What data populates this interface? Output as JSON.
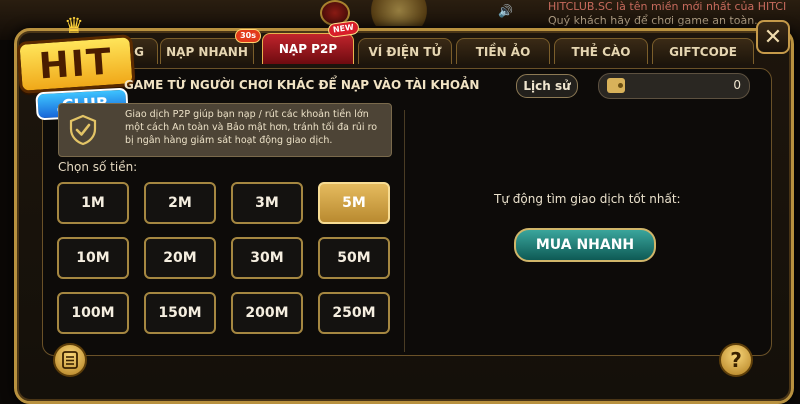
{
  "background": {
    "marquee_line1": "HITCLUB.SC là tên miền mới nhất của HITCI",
    "marquee_line2": "Quý khách hãy để chơi game an toàn."
  },
  "logo": {
    "hit": "HIT",
    "club": ".CLUB"
  },
  "tabs": [
    {
      "label": "NẠP NHANH",
      "badge": "30s"
    },
    {
      "label": "NẠP P2P",
      "badge": "NEW",
      "active": true
    },
    {
      "label": "VÍ ĐIỆN TỬ"
    },
    {
      "label": "TIỀN ẢO"
    },
    {
      "label": "THẺ CÀO"
    },
    {
      "label": "GIFTCODE"
    }
  ],
  "first_tab_fragment": "G",
  "close_icon": "close-icon",
  "header": {
    "subtitle": "GAME TỪ NGƯỜI CHƠI KHÁC ĐỂ NẠP VÀO TÀI KHOẢN",
    "history_label": "Lịch sử",
    "balance": "0"
  },
  "info": {
    "text": "Giao dịch P2P giúp bạn nạp / rút các khoản tiền lớn một cách An toàn và Bảo mật hơn, tránh tối đa rủi ro bị ngân hàng giám sát hoạt động giao dịch."
  },
  "amount_label": "Chọn số tiền:",
  "amounts": [
    "1M",
    "2M",
    "3M",
    "5M",
    "10M",
    "20M",
    "30M",
    "50M",
    "100M",
    "150M",
    "200M",
    "250M"
  ],
  "selected_amount": "5M",
  "right_panel": {
    "auto_label": "Tự động tìm giao dịch tốt nhất:",
    "buy_label": "MUA NHANH"
  },
  "bottom": {
    "menu_icon": "list-icon",
    "help_label": "?"
  },
  "colors": {
    "accent_gold": "#b8913f",
    "active_tab": "#c1242c",
    "buy_button": "#1f7d76",
    "selected_amount": "#d9ae4f"
  }
}
